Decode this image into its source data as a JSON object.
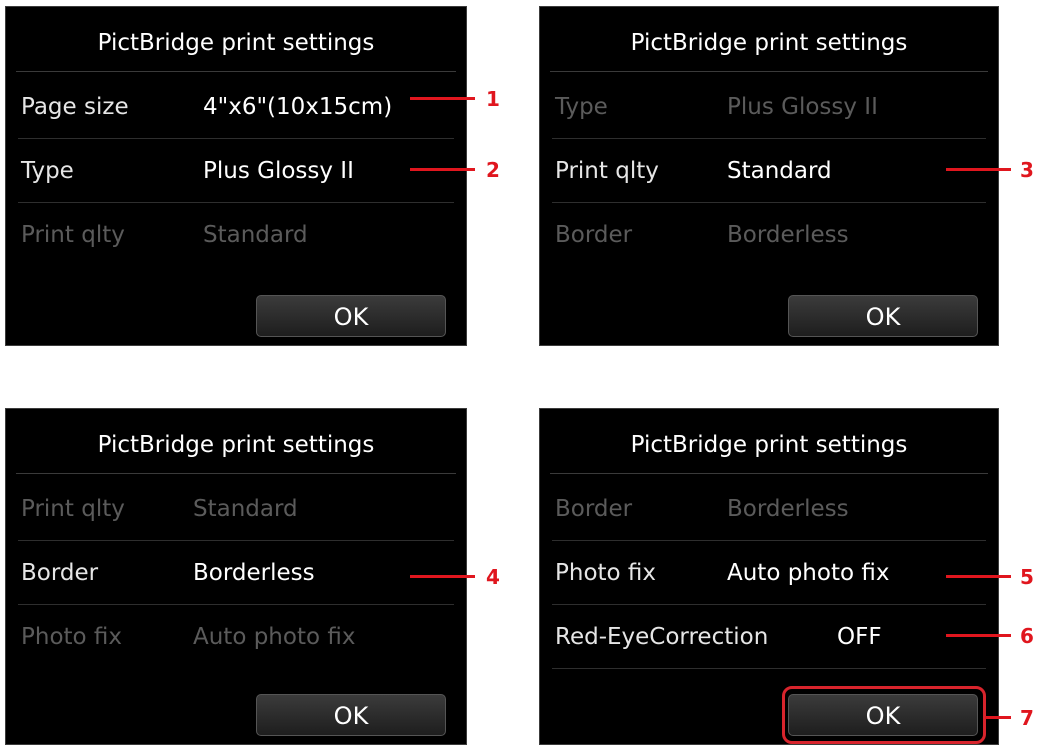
{
  "screens": [
    {
      "title": "PictBridge print settings",
      "rows": [
        {
          "label": "Page size",
          "value": "4\"x6\"(10x15cm)"
        },
        {
          "label": "Type",
          "value": "Plus Glossy II"
        },
        {
          "label": "Print qlty",
          "value": "Standard"
        }
      ],
      "ok_label": "OK"
    },
    {
      "title": "PictBridge print settings",
      "rows": [
        {
          "label": "Type",
          "value": "Plus Glossy II"
        },
        {
          "label": "Print qlty",
          "value": "Standard"
        },
        {
          "label": "Border",
          "value": "Borderless"
        }
      ],
      "ok_label": "OK"
    },
    {
      "title": "PictBridge print settings",
      "rows": [
        {
          "label": "Print qlty",
          "value": "Standard"
        },
        {
          "label": "Border",
          "value": "Borderless"
        },
        {
          "label": "Photo fix",
          "value": "Auto photo fix"
        }
      ],
      "ok_label": "OK"
    },
    {
      "title": "PictBridge print settings",
      "rows": [
        {
          "label": "Border",
          "value": "Borderless"
        },
        {
          "label": "Photo fix",
          "value": "Auto photo fix"
        },
        {
          "label": "Red-EyeCorrection",
          "value": "OFF"
        }
      ],
      "ok_label": "OK"
    }
  ],
  "callouts": [
    "1",
    "2",
    "3",
    "4",
    "5",
    "6",
    "7"
  ],
  "colors": {
    "screen_bg": "#000000",
    "callout_red": "#e0161e",
    "dim_text": "#5b5b5b"
  }
}
